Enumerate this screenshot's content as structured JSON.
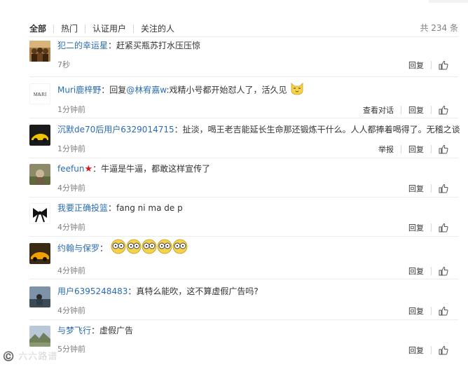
{
  "tabs": [
    "全部",
    "热门",
    "认证用户",
    "关注的人"
  ],
  "total": "共 234 条",
  "actions": {
    "reply": "回复",
    "view_conversation": "查看对话",
    "report": "举报"
  },
  "comments": [
    {
      "user": "犯二的幸运星",
      "sep": "：",
      "text": "赶紧买瓶苏打水压压惊",
      "time": "7秒"
    },
    {
      "user": "Muri鹿梓野",
      "sep": "：",
      "reply_prefix": "回复",
      "mention": "@林宥嘉w",
      "text": ":戏精小号都开始怼人了，活久见",
      "time": "1分钟前"
    },
    {
      "user": "沉默de70后用户6329014715",
      "sep": "：",
      "text": "扯淡，喝王老吉能延长生命那还锻炼干什么。人人都捧着喝得了。无稽之谈",
      "time": "1分钟前"
    },
    {
      "user": "feefun",
      "sep": "：",
      "text": "牛逼是牛逼，都敢这样宣传了",
      "time": "4分钟前"
    },
    {
      "user": "我要正确投篮",
      "sep": "：",
      "text": "fang ni ma de p",
      "time": "4分钟前"
    },
    {
      "user": "约翰与保罗",
      "sep": "：",
      "text": "",
      "time": "4分钟前"
    },
    {
      "user": "用户6395248483",
      "sep": "：",
      "text": "真特么能吹，这不算虚假广告吗?",
      "time": "4分钟前"
    },
    {
      "user": "与梦飞行",
      "sep": "：",
      "text": "虚假广告",
      "time": "5分钟前"
    }
  ],
  "watermark": "©️ 六六路谱",
  "colors": {
    "link": "#2b6cb0",
    "muted": "#808080",
    "divider": "#ececec"
  }
}
